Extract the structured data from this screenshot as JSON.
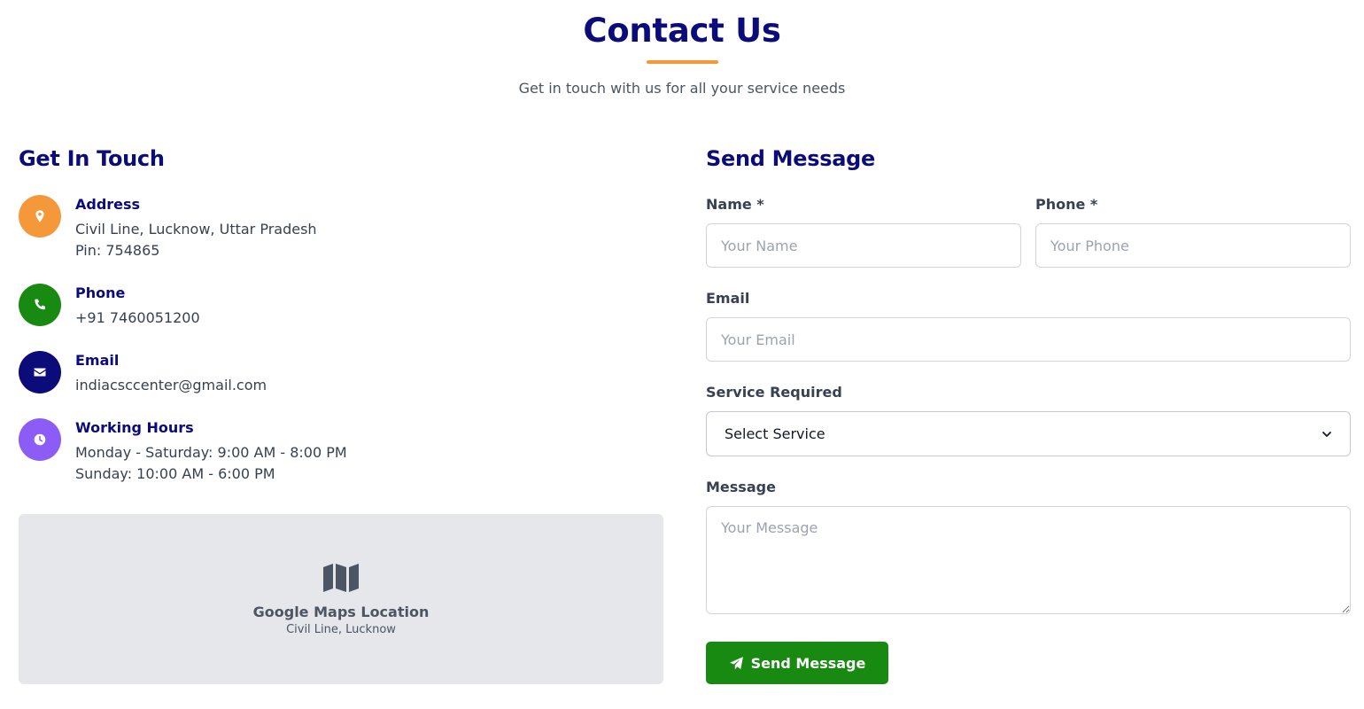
{
  "header": {
    "title": "Contact Us",
    "subtitle": "Get in touch with us for all your service needs"
  },
  "colors": {
    "brand_navy": "#0b0b7a",
    "accent_orange": "#f5983a",
    "phone_green": "#188a12",
    "email_navy": "#0b0b7a",
    "hours_purple": "#8b5cf6",
    "button_green": "#188a12"
  },
  "get_in_touch": {
    "heading": "Get In Touch",
    "items": [
      {
        "icon": "location-pin-icon",
        "title": "Address",
        "lines": [
          "Civil Line, Lucknow, Uttar Pradesh",
          "Pin: 754865"
        ]
      },
      {
        "icon": "phone-icon",
        "title": "Phone",
        "lines": [
          "+91 7460051200"
        ]
      },
      {
        "icon": "envelope-icon",
        "title": "Email",
        "lines": [
          "indiacsccenter@gmail.com"
        ]
      },
      {
        "icon": "clock-icon",
        "title": "Working Hours",
        "lines": [
          "Monday - Saturday: 9:00 AM - 8:00 PM",
          "Sunday: 10:00 AM - 6:00 PM"
        ]
      }
    ],
    "map": {
      "icon": "map-icon",
      "title": "Google Maps Location",
      "subtitle": "Civil Line, Lucknow"
    }
  },
  "form": {
    "heading": "Send Message",
    "name": {
      "label": "Name *",
      "placeholder": "Your Name",
      "value": ""
    },
    "phone": {
      "label": "Phone *",
      "placeholder": "Your Phone",
      "value": ""
    },
    "email": {
      "label": "Email",
      "placeholder": "Your Email",
      "value": ""
    },
    "service": {
      "label": "Service Required",
      "selected": "Select Service"
    },
    "message": {
      "label": "Message",
      "placeholder": "Your Message",
      "value": ""
    },
    "submit": {
      "label": "Send Message",
      "icon": "paper-plane-icon"
    }
  }
}
